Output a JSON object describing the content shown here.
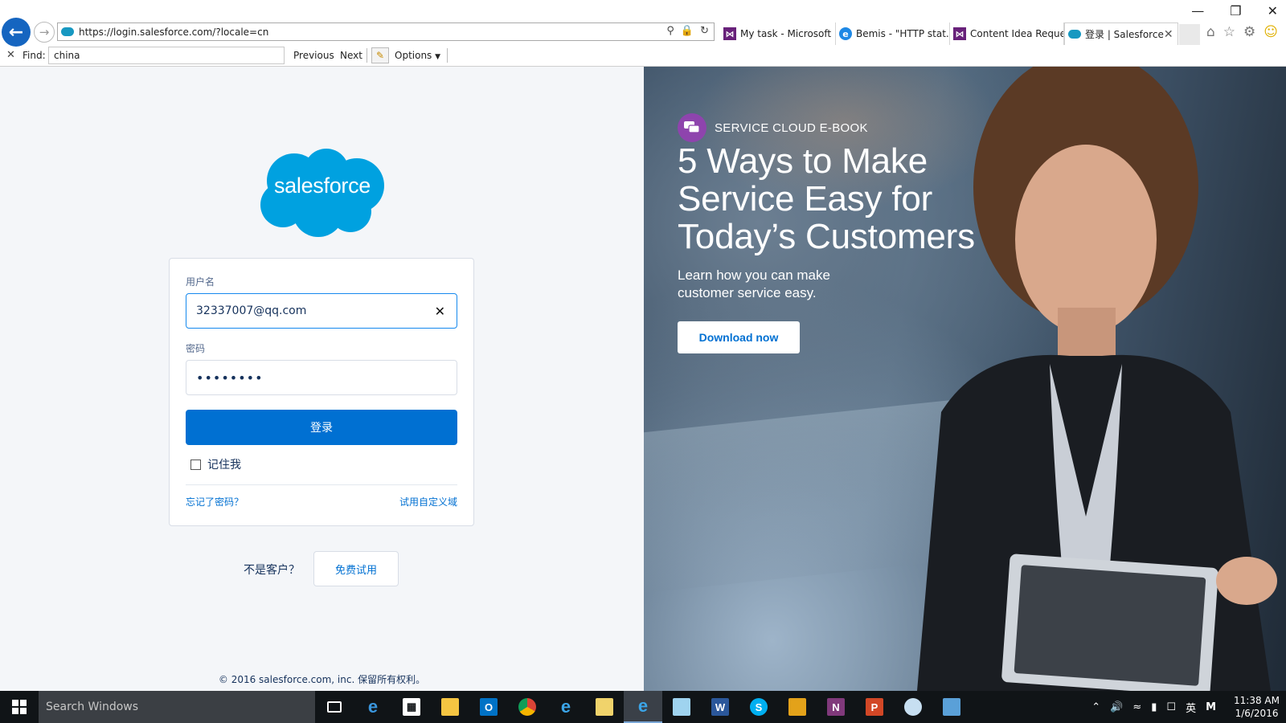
{
  "browser": {
    "url": "https://login.salesforce.com/?locale=cn",
    "tabs": [
      {
        "label": "My task - Microsoft ...",
        "icon": "visual-studio-icon"
      },
      {
        "label": "Bemis - \"HTTP stat...",
        "icon": "ie-icon"
      },
      {
        "label": "Content Idea Reque...",
        "icon": "visual-studio-icon"
      },
      {
        "label": "登录 | Salesforce",
        "icon": "salesforce-icon",
        "active": true
      }
    ],
    "find_bar": {
      "label": "Find:",
      "value": "china",
      "previous": "Previous",
      "next": "Next",
      "options": "Options"
    }
  },
  "login": {
    "logo_text": "salesforce",
    "username_label": "用户名",
    "username_value": "32337007@qq.com",
    "password_label": "密码",
    "password_value": "••••••••",
    "login_button": "登录",
    "remember_me": "记住我",
    "forgot_password": "忘记了密码？",
    "custom_domain": "试用自定义域",
    "not_customer": "不是客户？",
    "free_trial": "免费试用",
    "footer": "© 2016 salesforce.com, inc. 保留所有权利。"
  },
  "promo": {
    "tag": "SERVICE CLOUD E-BOOK",
    "headline": "5 Ways to Make Service Easy for Today’s Customers",
    "subtext": "Learn how you can make customer service easy.",
    "cta": "Download now"
  },
  "taskbar": {
    "search_placeholder": "Search Windows",
    "apps": [
      "task-view-icon",
      "edge-icon",
      "store-icon",
      "file-explorer-icon",
      "outlook-icon",
      "chrome-icon",
      "ie-icon",
      "windows-explorer-icon",
      "ie-icon",
      "notepad-icon",
      "word-icon",
      "skype-icon",
      "app-icon",
      "onenote-icon",
      "powerpoint-icon",
      "paint-icon",
      "remote-desktop-icon"
    ],
    "ime": "英",
    "ime_mode": "M",
    "time": "11:38 AM",
    "date": "1/6/2016"
  },
  "colors": {
    "salesforce_blue": "#00A1E0",
    "button_blue": "#0070D2",
    "chat_purple": "#8E44AD"
  }
}
